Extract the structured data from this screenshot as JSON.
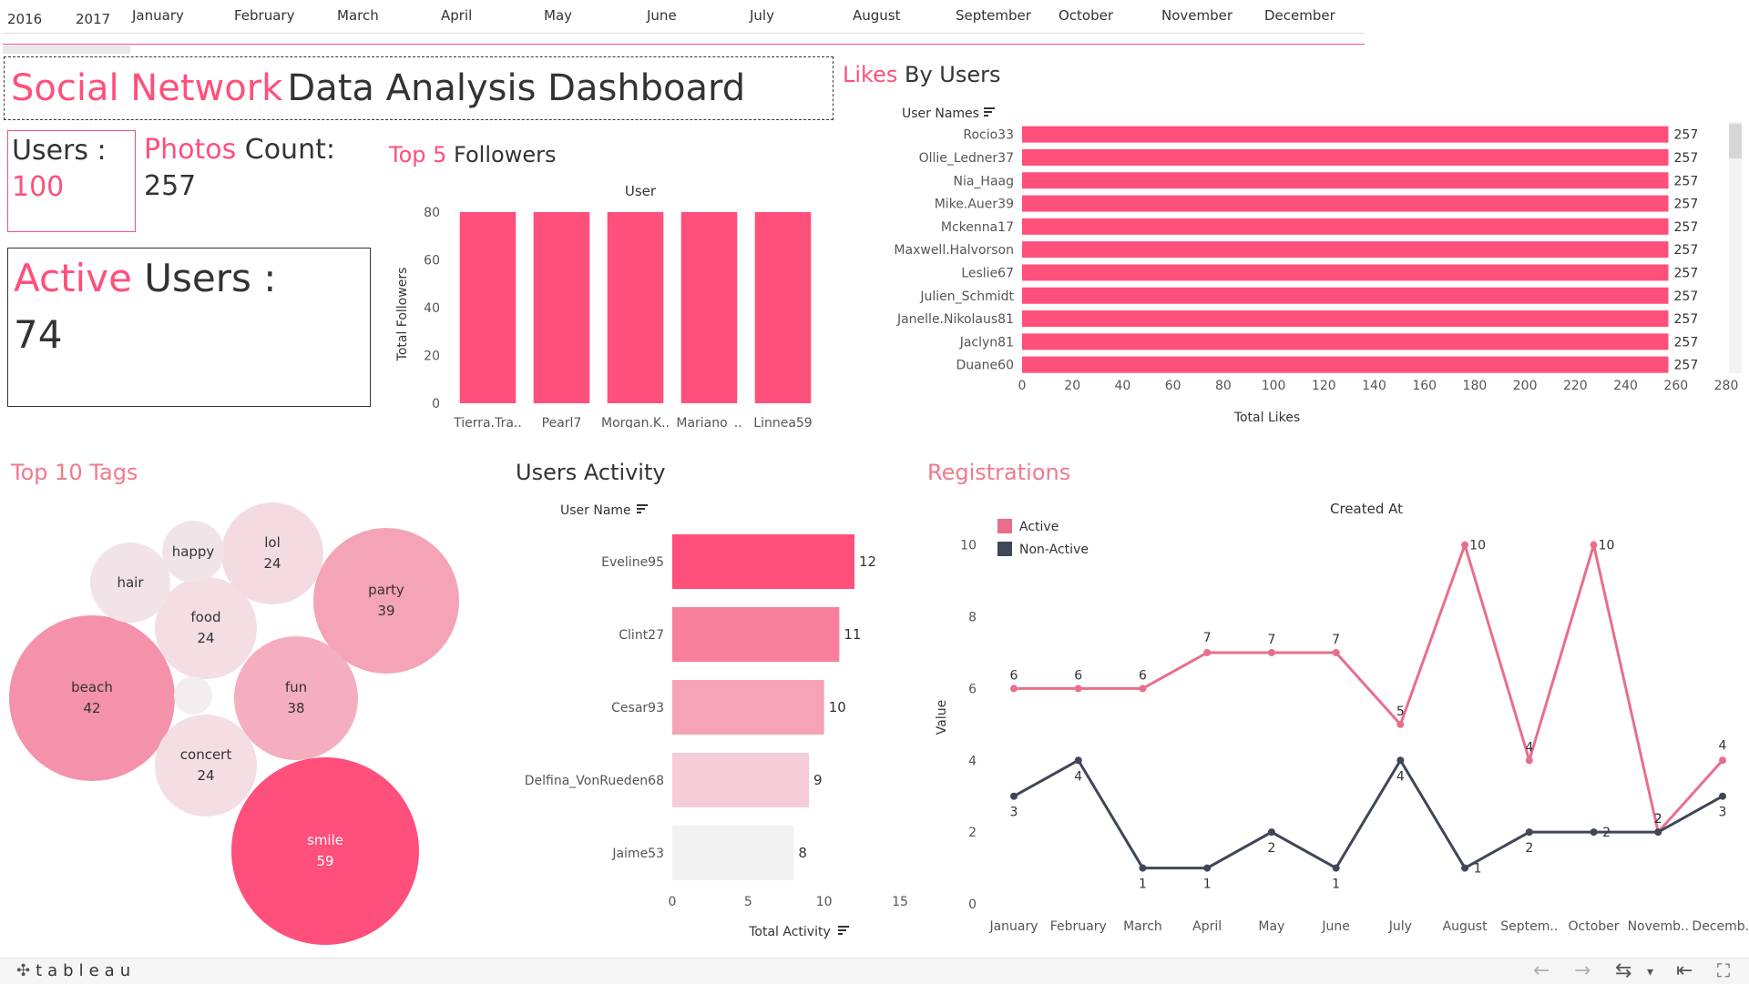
{
  "timeline": {
    "years": [
      "2016",
      "2017"
    ],
    "months": [
      "January",
      "February",
      "March",
      "April",
      "May",
      "June",
      "July",
      "August",
      "September",
      "October",
      "November",
      "December"
    ]
  },
  "title": {
    "highlight": "Social Network",
    "rest": "Data Analysis Dashboard"
  },
  "kpis": {
    "users": {
      "label": "Users :",
      "value": "100"
    },
    "photos": {
      "label_highlight": "Photos",
      "label_rest": " Count:",
      "value": "257"
    },
    "active": {
      "label_highlight": "Active",
      "label_rest": " Users :",
      "value": "74"
    }
  },
  "colors": {
    "accent": "#ff4f7b",
    "dark_series": "#3f4756",
    "active_line": "#e96e8c",
    "text": "#333333"
  },
  "chart_data": [
    {
      "id": "top5_followers",
      "type": "bar",
      "title_highlight": "Top 5",
      "title_rest": " Followers",
      "header": "User",
      "ylabel": "Total Followers",
      "categories": [
        "Tierra.Tra..",
        "Pearl7",
        "Morgan.K..",
        "Mariano_..",
        "Linnea59"
      ],
      "values": [
        80,
        80,
        80,
        80,
        80
      ],
      "yticks": [
        0,
        20,
        40,
        60,
        80
      ],
      "ylim": [
        0,
        80
      ],
      "grid": false
    },
    {
      "id": "likes_by_users",
      "type": "bar",
      "orientation": "horizontal",
      "title_highlight": "Likes",
      "title_rest": " By Users",
      "ylabel": "User Names",
      "xlabel": "Total Likes",
      "categories": [
        "Rocio33",
        "Ollie_Ledner37",
        "Nia_Haag",
        "Mike.Auer39",
        "Mckenna17",
        "Maxwell.Halvorson",
        "Leslie67",
        "Julien_Schmidt",
        "Janelle.Nikolaus81",
        "Jaclyn81",
        "Duane60"
      ],
      "values": [
        257,
        257,
        257,
        257,
        257,
        257,
        257,
        257,
        257,
        257,
        257
      ],
      "value_labels": [
        "257",
        "257",
        "257",
        "257",
        "257",
        "257",
        "257",
        "257",
        "257",
        "257",
        "257"
      ],
      "xticks": [
        0,
        20,
        40,
        60,
        80,
        100,
        120,
        140,
        160,
        180,
        200,
        220,
        240,
        260,
        280
      ],
      "xlim": [
        0,
        280
      ],
      "grid": false
    },
    {
      "id": "top10_tags",
      "type": "bubble",
      "title": "Top 10 Tags",
      "bubbles": [
        {
          "tag": "smile",
          "value": "59",
          "count": 59
        },
        {
          "tag": "beach",
          "value": "42",
          "count": 42
        },
        {
          "tag": "party",
          "value": "39",
          "count": 39
        },
        {
          "tag": "fun",
          "value": "38",
          "count": 38
        },
        {
          "tag": "lol",
          "value": "24",
          "count": 24
        },
        {
          "tag": "food",
          "value": "24",
          "count": 24
        },
        {
          "tag": "concert",
          "value": "24",
          "count": 24
        },
        {
          "tag": "hair",
          "value": "",
          "count": null
        },
        {
          "tag": "happy",
          "value": "",
          "count": null
        },
        {
          "tag": "",
          "value": "",
          "count": null
        }
      ]
    },
    {
      "id": "users_activity",
      "type": "bar",
      "orientation": "horizontal",
      "title": "Users Activity",
      "ylabel": "User Name",
      "xlabel": "Total Activity",
      "categories": [
        "Eveline95",
        "Clint27",
        "Cesar93",
        "Delfina_VonRueden68",
        "Jaime53"
      ],
      "values": [
        12,
        11,
        10,
        9,
        8
      ],
      "value_labels": [
        "12",
        "11",
        "10",
        "9",
        "8"
      ],
      "xticks": [
        0,
        5,
        10,
        15
      ],
      "xlim": [
        0,
        15
      ],
      "grid": false
    },
    {
      "id": "registrations",
      "type": "line",
      "title": "Registrations",
      "header": "Created At",
      "ylabel": "Value",
      "categories": [
        "January",
        "February",
        "March",
        "April",
        "May",
        "June",
        "July",
        "August",
        "Septem..",
        "October",
        "Novemb..",
        "Decemb.."
      ],
      "series": [
        {
          "name": "Active",
          "values": [
            6,
            6,
            6,
            7,
            7,
            7,
            5,
            10,
            4,
            10,
            2,
            4
          ]
        },
        {
          "name": "Non-Active",
          "values": [
            3,
            4,
            1,
            1,
            2,
            1,
            4,
            1,
            2,
            2,
            2,
            3
          ]
        }
      ],
      "yticks": [
        0,
        2,
        4,
        6,
        8,
        10
      ],
      "ylim": [
        0,
        10.6
      ],
      "legend": "top-left",
      "grid": false
    }
  ],
  "footer": {
    "brand": "tableau"
  }
}
